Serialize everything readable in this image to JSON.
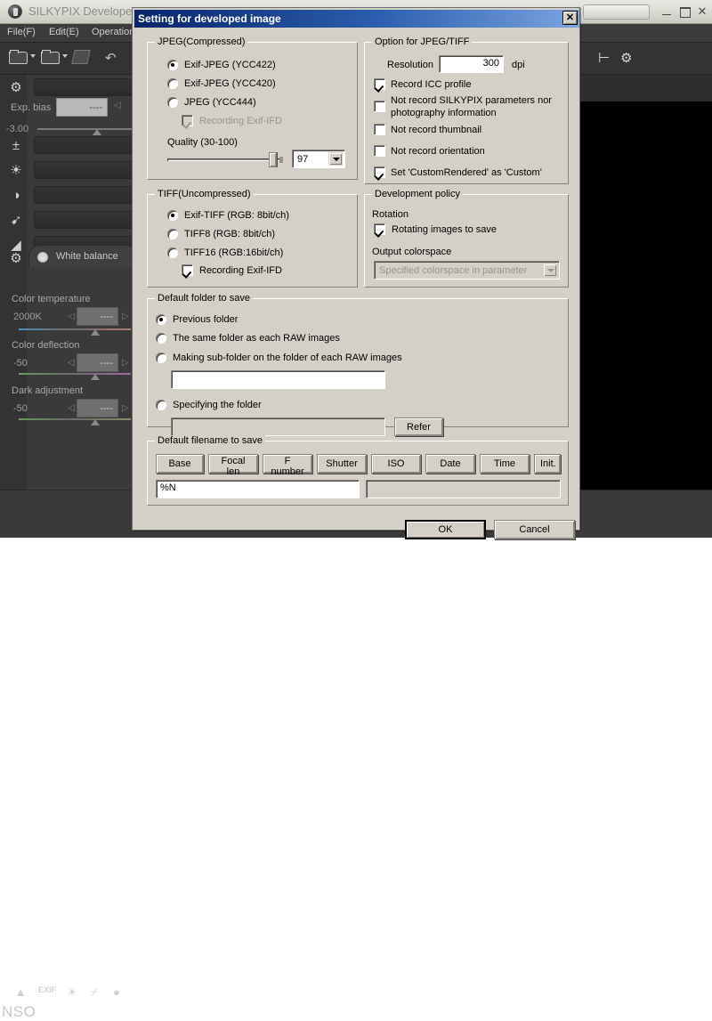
{
  "app": {
    "title": "SILKYPIX Developer",
    "icon": "silkypix-logo-icon",
    "menus": [
      {
        "label": "File(F)"
      },
      {
        "label": "Edit(E)"
      },
      {
        "label": "Operation("
      }
    ],
    "window_buttons": {
      "minimize": "–",
      "maximize": "□",
      "close": "✕"
    },
    "toolbar": {
      "open_folder": "open-folder-icon",
      "open_folder2": "open-folder-alt-icon",
      "brush": "brush-icon",
      "undo": "undo-icon"
    },
    "left_panel": {
      "exposure_label": "Exp. bias",
      "exposure_value": "----",
      "exposure_min": "-3.00",
      "tab_label": "White balance",
      "controls": [
        {
          "label": "Color temperature",
          "value_text": "2000K",
          "box_value": "----"
        },
        {
          "label": "Color deflection",
          "value_text": "-50",
          "box_value": "----"
        },
        {
          "label": "Dark adjustment",
          "value_text": "-50",
          "box_value": "----"
        }
      ],
      "icons": [
        "gear-icon",
        "exposure-icon",
        "brightness-icon",
        "contrast-icon",
        "sharpness-icon",
        "noise-icon",
        "settings-plus-icon"
      ]
    },
    "statusbar": {
      "text": "NSO",
      "icons": [
        "histogram-icon",
        "exif-icon",
        "highlight-icon",
        "tone-curve-icon",
        "sphere-icon"
      ]
    },
    "logo_mark": "®"
  },
  "dialog": {
    "title": "Setting for developed image",
    "close_label": "✕",
    "jpeg": {
      "legend": "JPEG(Compressed)",
      "options": [
        {
          "label": "Exif-JPEG  (YCC422)",
          "selected": true
        },
        {
          "label": "Exif-JPEG  (YCC420)",
          "selected": false
        },
        {
          "label": "JPEG  (YCC444)",
          "selected": false
        }
      ],
      "recording_exif_label": "Recording Exif-IFD",
      "recording_exif_checked": true,
      "recording_exif_disabled": true,
      "quality_label": "Quality (30-100)",
      "quality_value": "97",
      "quality_min": 30,
      "quality_max": 100
    },
    "option_jpeg_tiff": {
      "legend": "Option for JPEG/TIFF",
      "resolution_label": "Resolution",
      "resolution_value": "300",
      "resolution_unit": "dpi",
      "checkboxes": [
        {
          "label": "Record ICC profile",
          "checked": true
        },
        {
          "label": "Not record SILKYPIX parameters nor",
          "label2": "photography information",
          "checked": false
        },
        {
          "label": "Not record thumbnail",
          "checked": false
        },
        {
          "label": "Not record orientation",
          "checked": false
        },
        {
          "label": "Set 'CustomRendered' as 'Custom'",
          "checked": true
        }
      ]
    },
    "tiff": {
      "legend": "TIFF(Uncompressed)",
      "options": [
        {
          "label": "Exif-TIFF (RGB: 8bit/ch)",
          "selected": true
        },
        {
          "label": "TIFF8  (RGB: 8bit/ch)",
          "selected": false
        },
        {
          "label": "TIFF16  (RGB:16bit/ch)",
          "selected": false
        }
      ],
      "recording_exif_label": "Recording Exif-IFD",
      "recording_exif_checked": true
    },
    "development_policy": {
      "legend": "Development policy",
      "rotation_label": "Rotation",
      "rotating_label": "Rotating images to save",
      "rotating_checked": true,
      "colorspace_label": "Output colorspace",
      "colorspace_value": "Specified colorspace in parameter",
      "colorspace_disabled": true
    },
    "default_folder": {
      "legend": "Default folder to save",
      "options": [
        {
          "label": "Previous folder",
          "selected": true
        },
        {
          "label": "The same folder as each RAW images",
          "selected": false
        },
        {
          "label": "Making sub-folder on the folder of each RAW images",
          "selected": false
        },
        {
          "label": "Specifying the folder",
          "selected": false
        }
      ],
      "subfolder_value": "",
      "folder_value": "",
      "refer_label": "Refer"
    },
    "default_filename": {
      "legend": "Default filename to save",
      "buttons": [
        {
          "label": "Base"
        },
        {
          "label": "Focal len"
        },
        {
          "label": "F number"
        },
        {
          "label": "Shutter"
        },
        {
          "label": "ISO"
        },
        {
          "label": "Date"
        },
        {
          "label": "Time"
        },
        {
          "label": "Init."
        }
      ],
      "pattern_value": "%N",
      "preview_value": ""
    },
    "ok_label": "OK",
    "cancel_label": "Cancel"
  },
  "colors": {
    "dialog_face": "#d4d0c8",
    "titlebar_start": "#0a246a",
    "titlebar_end": "#7ba3e0",
    "app_dark": "#333333",
    "canvas": "#000000",
    "accent_blue": "#2b3a9c"
  }
}
